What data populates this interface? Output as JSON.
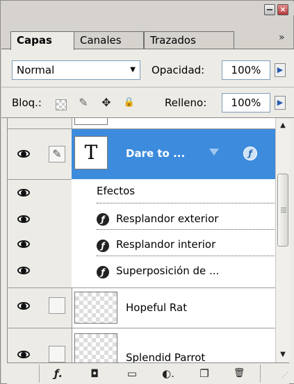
{
  "window": {
    "close_glyph": "×"
  },
  "tabs": [
    {
      "label": "Capas",
      "active": true
    },
    {
      "label": "Canales",
      "active": false
    },
    {
      "label": "Trazados",
      "active": false
    }
  ],
  "tabs_menu_glyph": "»",
  "blend_mode": {
    "value": "Normal",
    "arrow": "▼"
  },
  "opacity": {
    "label": "Opacidad:",
    "value": "100%",
    "arrow": "▶"
  },
  "lock": {
    "label": "Bloq.:",
    "icons": [
      "lock-transparent-pixels-icon",
      "lock-image-pixels-icon",
      "lock-position-icon",
      "lock-all-icon"
    ],
    "brush_glyph": "✎",
    "move_glyph": "✥",
    "padlock_glyph": "🔒"
  },
  "fill": {
    "label": "Relleno:",
    "value": "100%",
    "arrow": "▶"
  },
  "layers": {
    "selected": {
      "thumb_letter": "T",
      "name": "Dare to ...",
      "fx_glyph": "ƒ",
      "link_glyph": "✎"
    },
    "effects_title": "Efectos",
    "effects": [
      {
        "name": "Resplandor exterior",
        "glyph": "ƒ"
      },
      {
        "name": "Resplandor interior",
        "glyph": "ƒ"
      },
      {
        "name": "Superposición de ...",
        "glyph": "ƒ"
      }
    ],
    "others": [
      {
        "name": "Hopeful Rat"
      },
      {
        "name": "Splendid Parrot"
      }
    ]
  },
  "scrollbar": {
    "up": "▲",
    "down": "▼"
  },
  "toolbar": {
    "buttons": [
      {
        "icon": "add-layer-style-icon",
        "glyph": "ƒ."
      },
      {
        "icon": "add-mask-icon",
        "glyph": "◘"
      },
      {
        "icon": "new-group-icon",
        "glyph": "▭"
      },
      {
        "icon": "new-adjustment-layer-icon",
        "glyph": "◐."
      },
      {
        "icon": "new-layer-icon",
        "glyph": "❐"
      },
      {
        "icon": "delete-layer-icon",
        "glyph": "🗑"
      }
    ]
  },
  "colors": {
    "selection": "#3d8bdc",
    "panel": "#ecebe6"
  }
}
